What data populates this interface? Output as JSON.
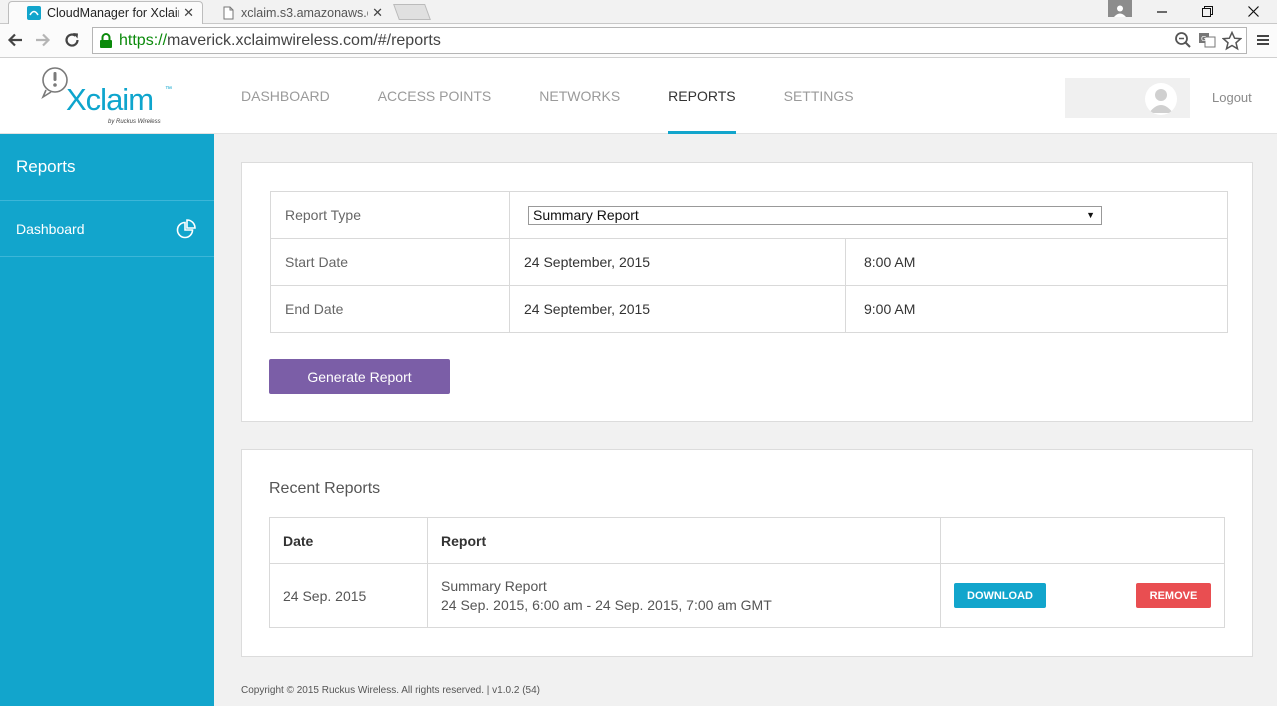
{
  "browser": {
    "tabs": [
      {
        "title": "CloudManager for Xclaim",
        "active": true
      },
      {
        "title": "xclaim.s3.amazonaws.com",
        "active": false
      }
    ],
    "url_scheme": "https://",
    "url_rest": "maverick.xclaimwireless.com/#/reports"
  },
  "brand": {
    "name": "Xclaim",
    "tm": "™",
    "tagline": "by Ruckus Wireless",
    "accent": "#12a5cc"
  },
  "topnav": {
    "items": [
      "DASHBOARD",
      "ACCESS POINTS",
      "NETWORKS",
      "REPORTS",
      "SETTINGS"
    ],
    "active": "REPORTS",
    "logout": "Logout"
  },
  "sidebar": {
    "title": "Reports",
    "items": [
      {
        "label": "Dashboard",
        "icon": "pie-chart-icon"
      }
    ]
  },
  "report_form": {
    "type_label": "Report Type",
    "type_value": "Summary Report",
    "start_label": "Start Date",
    "start_date": "24 September, 2015",
    "start_time": "8:00 AM",
    "end_label": "End Date",
    "end_date": "24 September, 2015",
    "end_time": "9:00 AM",
    "generate_label": "Generate Report",
    "generate_color": "#7b5ea7"
  },
  "recent": {
    "title": "Recent Reports",
    "headers": [
      "Date",
      "Report",
      ""
    ],
    "rows": [
      {
        "date": "24 Sep. 2015",
        "report_name": "Summary Report",
        "report_range": "24 Sep. 2015, 6:00 am - 24 Sep. 2015, 7:00 am GMT",
        "download_label": "DOWNLOAD",
        "remove_label": "REMOVE"
      }
    ],
    "download_color": "#12a5cc",
    "remove_color": "#e94e51"
  },
  "footer": {
    "copyright": "Copyright © 2015 Ruckus Wireless. All rights reserved. | v1.0.2 (54)"
  }
}
